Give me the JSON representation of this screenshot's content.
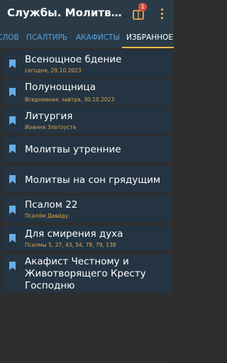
{
  "header": {
    "title": "Службы. Молитвослов",
    "notification_count": "1"
  },
  "tabs": [
    {
      "label": "СЛОВ",
      "active": false
    },
    {
      "label": "ПСАЛТИРЬ",
      "active": false
    },
    {
      "label": "АКАФИСТЫ",
      "active": false
    },
    {
      "label": "ИЗБРАННОЕ",
      "active": true
    }
  ],
  "favorites": [
    {
      "title": "Всенощное бдение",
      "subtitle": "сегодня, 29.10.2023"
    },
    {
      "title": "Полунощница",
      "subtitle": "Вседневная, завтра, 30.10.2023"
    },
    {
      "title": "Литургия",
      "subtitle": "Иоанна Златоуста"
    },
    {
      "title": "Молитвы утренние",
      "subtitle": ""
    },
    {
      "title": "Молитвы на сон грядущим",
      "subtitle": ""
    },
    {
      "title": "Псалом 22",
      "subtitle": "Псало́м Дави́ду."
    },
    {
      "title": "Для смирения духа",
      "subtitle": "Псалмы 5, 27, 43, 54, 78, 79, 138"
    },
    {
      "title_lines": [
        "Акафист Честному и",
        "Животворящего Кресту",
        "Господню"
      ],
      "subtitle": ""
    }
  ],
  "colors": {
    "accent": "#ffb84d",
    "tab_inactive": "#5aa0d8",
    "subtitle": "#e2a84a",
    "bookmark": "#6aaee6",
    "card": "#243442"
  },
  "icons": {
    "book": "book-icon",
    "more": "more-vert-icon",
    "bookmark": "bookmark-icon"
  }
}
